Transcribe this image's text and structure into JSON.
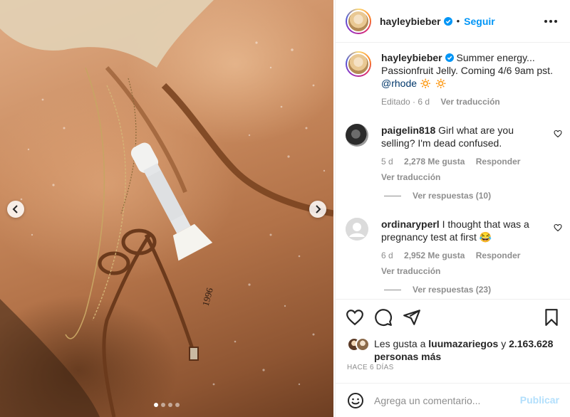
{
  "post": {
    "username": "hayleybieber",
    "separator": "•",
    "follow_label": "Seguir",
    "more_icon": "more-horizontal-icon"
  },
  "caption": {
    "username": "hayleybieber",
    "text": "Summer energy... Passionfruit Jelly. Coming 4/6 9am pst.",
    "mention": "@rhode",
    "emoji": "🔅 🔅",
    "edited": "Editado · 6 d",
    "translate": "Ver traducción"
  },
  "comments": [
    {
      "username": "paigelin818",
      "text": "Girl what are you selling? I'm dead confused.",
      "time": "5 d",
      "likes": "2,278 Me gusta",
      "reply": "Responder",
      "translate": "Ver traducción",
      "replies": "Ver respuestas (10)"
    },
    {
      "username": "ordinaryperl",
      "text": "I thought that was a pregnancy test at first 😂",
      "time": "6 d",
      "likes": "2,952 Me gusta",
      "reply": "Responder",
      "translate": "Ver traducción",
      "replies": "Ver respuestas (23)"
    }
  ],
  "likes": {
    "prefix": "Les gusta a",
    "user": "luumazariegos",
    "connector": "y",
    "count": "2.163.628",
    "suffix": "personas más"
  },
  "time_ago": "HACE 6 DÍAS",
  "add_comment": {
    "placeholder": "Agrega un comentario...",
    "post_label": "Publicar"
  },
  "carousel": {
    "total": 4,
    "active": 1
  },
  "colors": {
    "link_blue": "#0095f6",
    "muted": "#8e8e8e",
    "text": "#262626",
    "post_disabled": "#b2dffc"
  }
}
